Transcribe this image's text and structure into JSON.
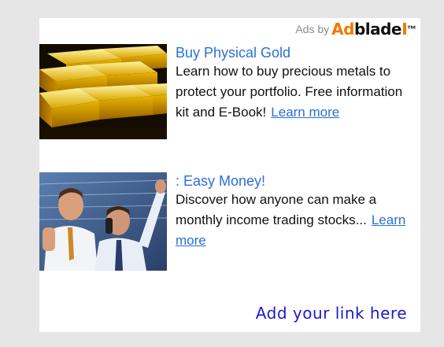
{
  "header": {
    "ads_by": "Ads by",
    "brand_ad": "Ad",
    "brand_blade": "blade",
    "brand_tm": "™"
  },
  "ads": [
    {
      "image": "gold-bars-image",
      "title": "Buy Physical Gold",
      "description": "Learn how to buy precious metals to protect your portfolio. Free information kit and E-Book!",
      "link_text": "Learn more"
    },
    {
      "image": "stock-traders-image",
      "title": ": Easy Money!",
      "description": "Discover how anyone can make a monthly income trading stocks...",
      "link_text": "Learn more"
    }
  ],
  "footer": {
    "add_link": "Add your link here"
  },
  "colors": {
    "page_background": "#e6e6e6",
    "ad_background": "#ffffff",
    "title_link": "#2a6fd6",
    "add_link": "#1a1acc",
    "brand_orange": "#f07a00"
  }
}
